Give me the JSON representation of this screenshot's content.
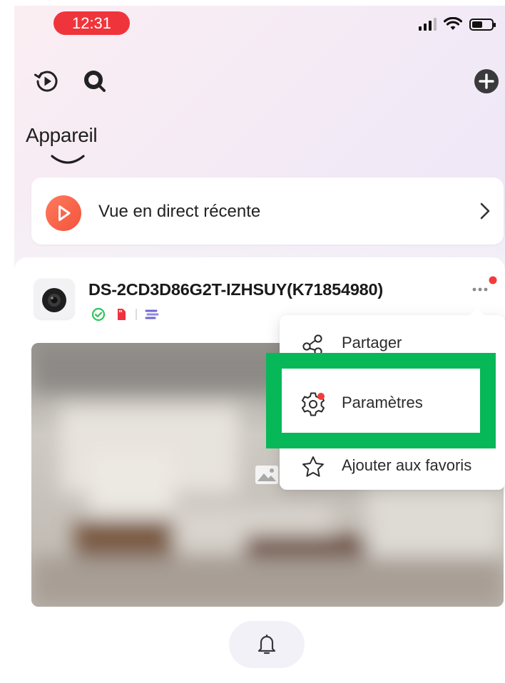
{
  "status_bar": {
    "time": "12:31",
    "battery_level": 0.55
  },
  "header": {
    "title": "Appareil"
  },
  "recent_live": {
    "label": "Vue en direct récente"
  },
  "device": {
    "name": "DS-2CD3D86G2T-IZHSUY(K71854980)"
  },
  "menu": {
    "items": [
      {
        "label": "Partager",
        "icon": "share-icon"
      },
      {
        "label": "Paramètres",
        "icon": "gear-icon"
      },
      {
        "label": "Ajouter aux favoris",
        "icon": "star-icon"
      }
    ]
  },
  "colors": {
    "time_pill": "#f0343b",
    "accent_orange": "#f2543c",
    "highlight_green": "#06b858",
    "online_green": "#2ec55b",
    "sd_red": "#ee3340",
    "cloud_purple": "#6d66d6",
    "notification_dot": "#f23c3c"
  }
}
